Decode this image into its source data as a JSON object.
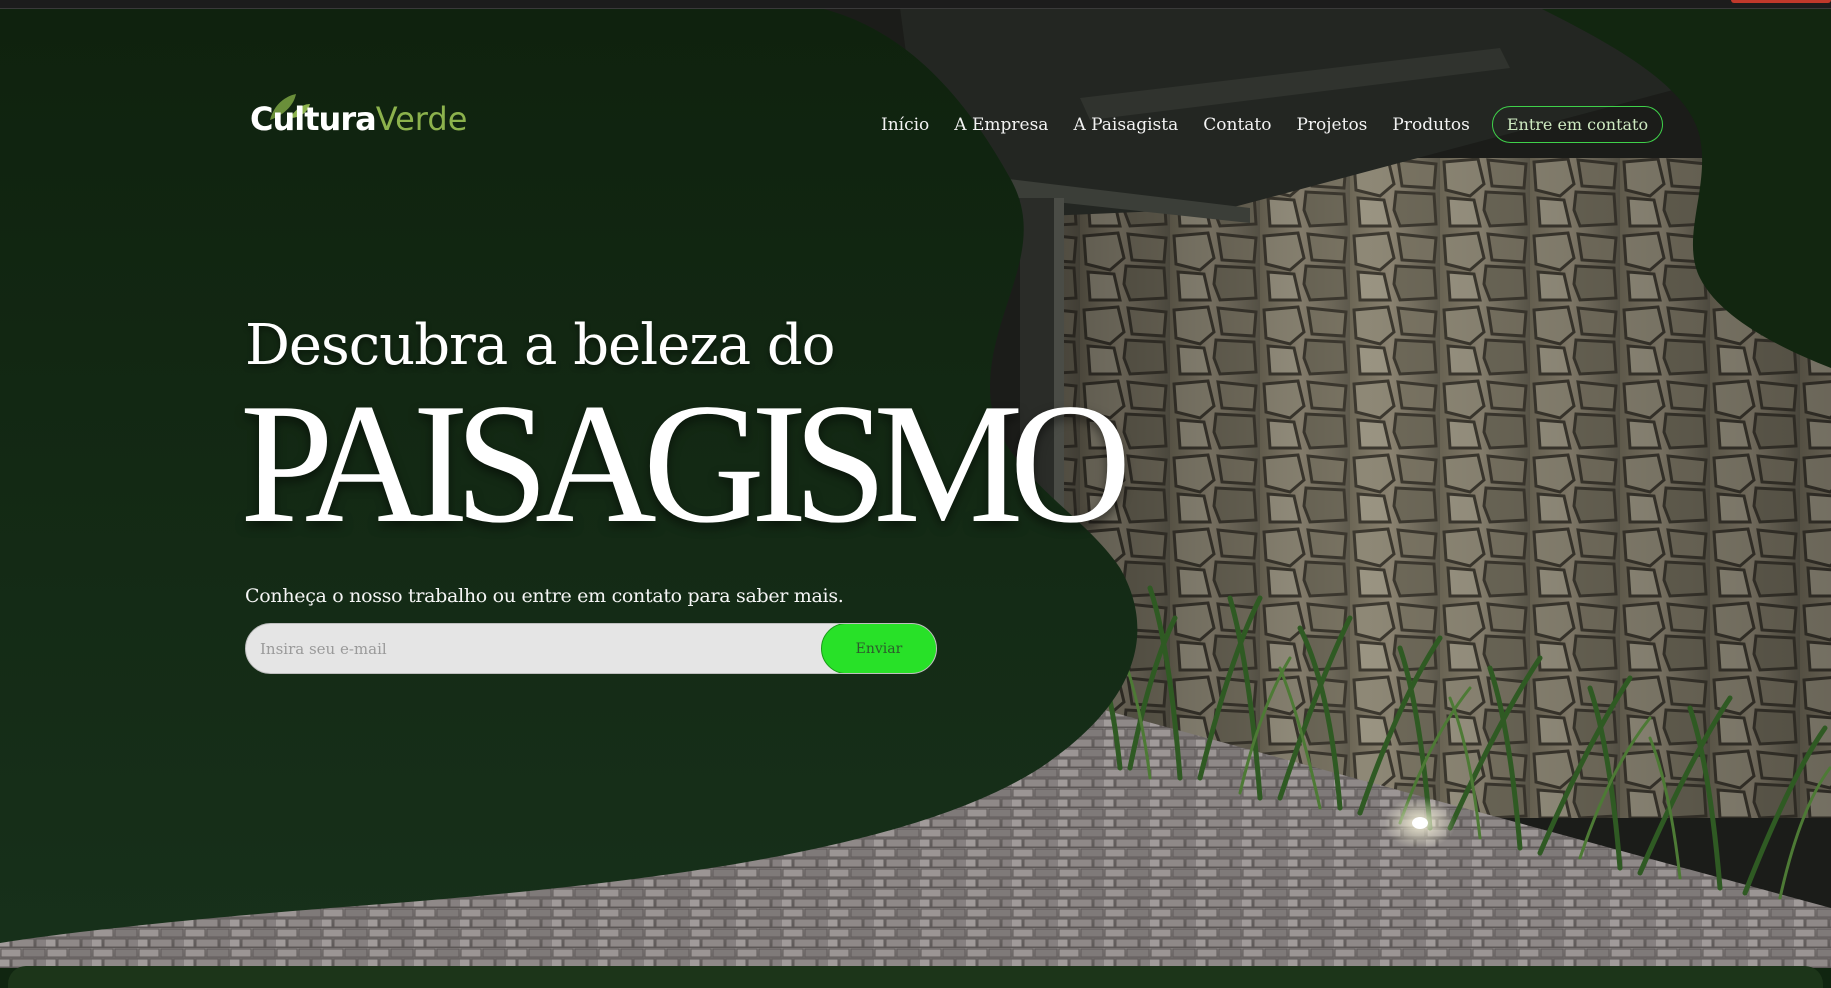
{
  "brand": {
    "name_bold": "Cultura",
    "name_light": "Verde",
    "logo_icon": "leaf-icon",
    "colors": {
      "bold": "#ffffff",
      "light": "#8cb24c"
    }
  },
  "nav": {
    "items": [
      {
        "label": "Início"
      },
      {
        "label": "A Empresa"
      },
      {
        "label": "A Paisagista"
      },
      {
        "label": "Contato"
      },
      {
        "label": "Projetos"
      },
      {
        "label": "Produtos"
      }
    ],
    "cta_label": "Entre em contato"
  },
  "hero": {
    "headline_line1": "Descubra a beleza do",
    "headline_line2": "PAISAGISMO",
    "subtitle": "Conheça o nosso trabalho ou entre em contato para saber mais.",
    "email_placeholder": "Insira seu e-mail",
    "submit_label": "Enviar"
  },
  "colors": {
    "background_green": "#12270f",
    "accent_green": "#28e128",
    "cta_border": "#3fd14a"
  }
}
